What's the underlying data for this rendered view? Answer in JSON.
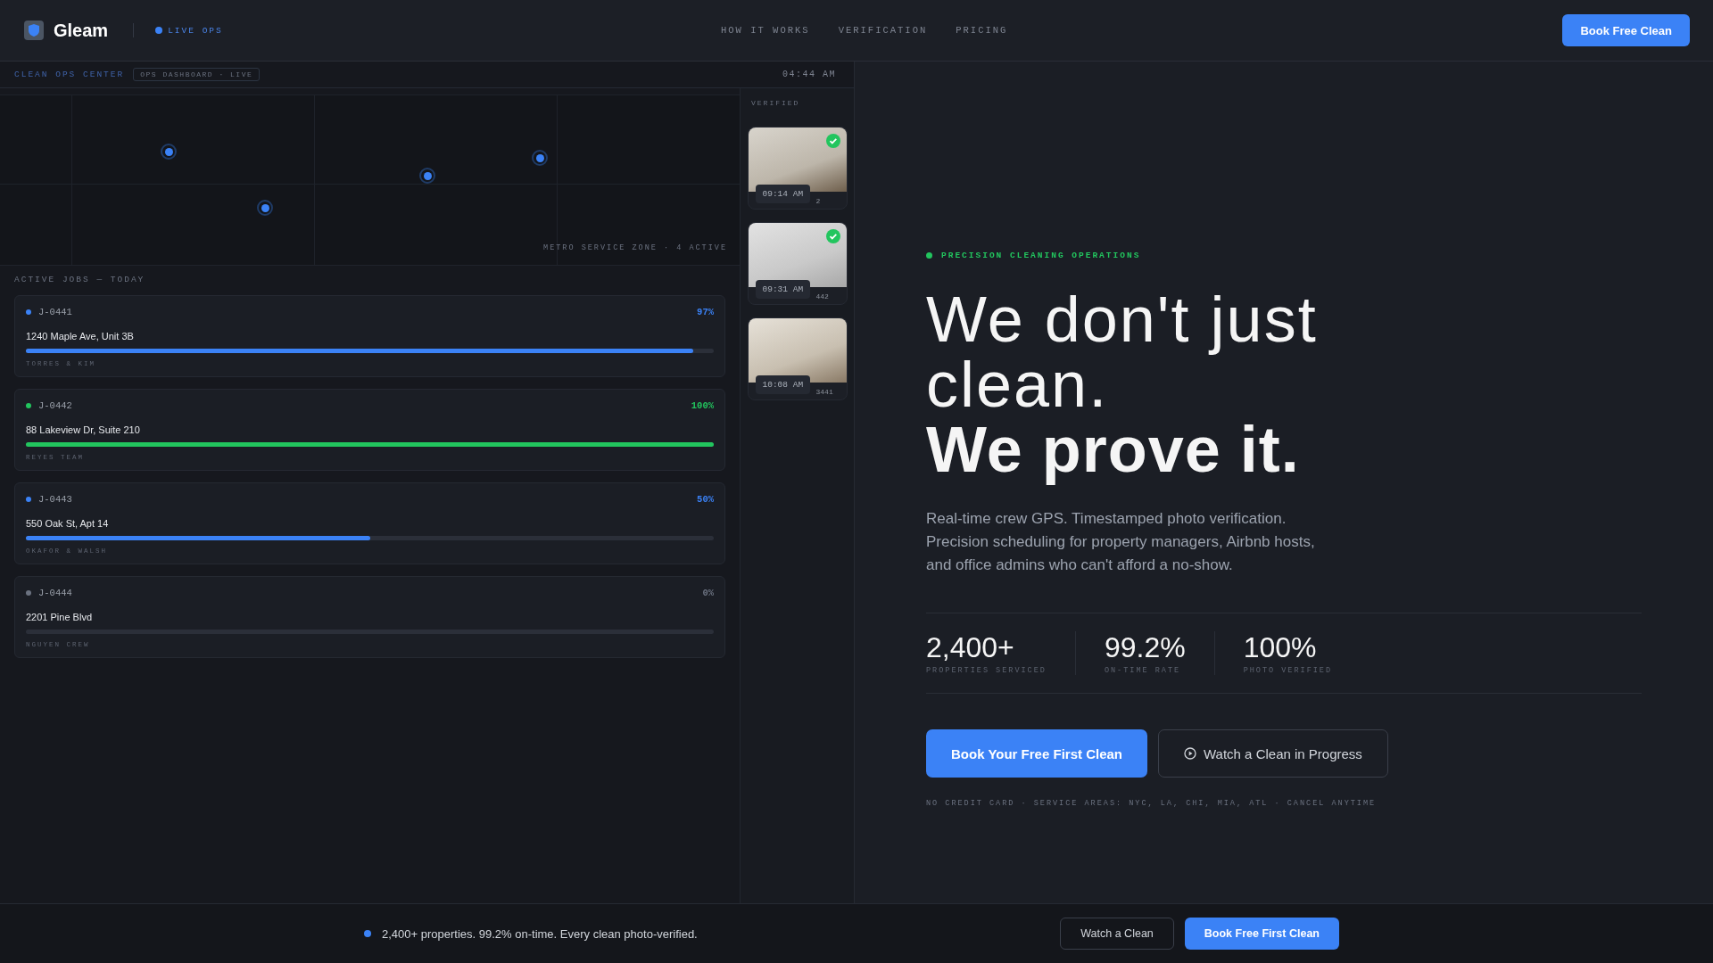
{
  "nav": {
    "brand": "Gleam",
    "live_badge": "LIVE OPS",
    "links": [
      {
        "label": "HOW IT WORKS"
      },
      {
        "label": "VERIFICATION"
      },
      {
        "label": "PRICING"
      }
    ],
    "cta": "Book Free Clean"
  },
  "dashboard": {
    "title": "CLEAN OPS CENTER",
    "badge": "OPS DASHBOARD · LIVE",
    "clock": "04:44 AM",
    "map_caption": "METRO SERVICE ZONE · 4 ACTIVE",
    "jobs_heading": "ACTIVE JOBS — TODAY",
    "jobs": [
      {
        "id": "J-0441",
        "percent": "97%",
        "address": "1240 Maple Ave, Unit 3B",
        "crew": "TORRES & KIM",
        "level": 0.97,
        "color": "#3b82f6"
      },
      {
        "id": "J-0442",
        "percent": "100%",
        "address": "88 Lakeview Dr, Suite 210",
        "crew": "REYES TEAM",
        "level": 1,
        "color": "#22c55e"
      },
      {
        "id": "J-0443",
        "percent": "50%",
        "address": "550 Oak St, Apt 14",
        "crew": "OKAFOR & WALSH",
        "level": 0.5,
        "color": "#3b82f6"
      },
      {
        "id": "J-0444",
        "percent": "0%",
        "address": "2201 Pine Blvd",
        "crew": "NGUYEN CREW",
        "level": 0,
        "color": "#6b7280"
      }
    ],
    "verified_heading": "VERIFIED",
    "photos": [
      {
        "time": "09:14 AM",
        "caption": "2",
        "verified": true
      },
      {
        "time": "09:31 AM",
        "caption": "442",
        "verified": true
      },
      {
        "time": "10:08 AM",
        "caption": "3441",
        "verified": false
      }
    ]
  },
  "hero": {
    "eyebrow": "PRECISION CLEANING OPERATIONS",
    "headline_lines": [
      "We don't just",
      "clean."
    ],
    "headline_strong": "We prove it.",
    "body": "Real-time crew GPS. Timestamped photo verification. Precision scheduling for property managers, Airbnb hosts, and office admins who can't afford a no-show.",
    "stats": [
      {
        "value": "2,400+",
        "label": "PROPERTIES SERVICED"
      },
      {
        "value": "99.2%",
        "label": "ON-TIME RATE"
      },
      {
        "value": "100%",
        "label": "PHOTO VERIFIED"
      }
    ],
    "primary_button": "Book Your Free First Clean",
    "secondary_button": "Watch a Clean in Progress",
    "fine_print": "NO CREDIT CARD · SERVICE AREAS: NYC, LA, CHI, MIA, ATL · CANCEL ANYTIME"
  },
  "bottom_bar": {
    "message": "2,400+ properties. 99.2% on-time. Every clean photo-verified.",
    "secondary_button": "Watch a Clean",
    "primary_button": "Book Free First Clean"
  }
}
